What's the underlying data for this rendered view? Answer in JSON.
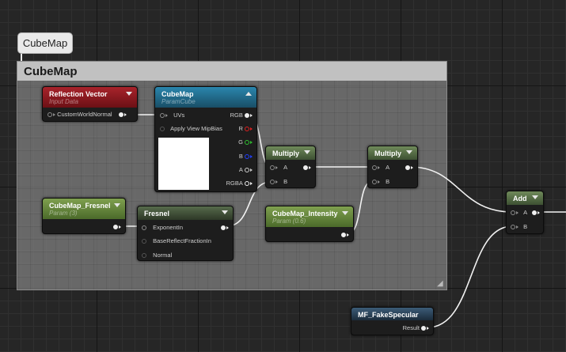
{
  "comment_tag": "CubeMap",
  "comment_title": "CubeMap",
  "nodes": {
    "reflection_vector": {
      "title": "Reflection Vector",
      "subtitle": "Input Data",
      "outputs": [
        "CustomWorldNormal"
      ]
    },
    "cubemap": {
      "title": "CubeMap",
      "subtitle": "ParamCube",
      "inputs": [
        "UVs",
        "Apply View MipBias"
      ],
      "outputs": [
        "RGB",
        "R",
        "G",
        "B",
        "A",
        "RGBA"
      ]
    },
    "cubemap_fresnel": {
      "title": "CubeMap_Fresnel",
      "subtitle": "Param (3)"
    },
    "fresnel": {
      "title": "Fresnel",
      "inputs": [
        "ExponentIn",
        "BaseReflectFractionIn",
        "Normal"
      ]
    },
    "multiply_1": {
      "title": "Multiply",
      "inputs": [
        "A",
        "B"
      ]
    },
    "cubemap_intensity": {
      "title": "CubeMap_Intensity",
      "subtitle": "Param (0.6)"
    },
    "multiply_2": {
      "title": "Multiply",
      "inputs": [
        "A",
        "B"
      ]
    },
    "add": {
      "title": "Add",
      "inputs": [
        "A",
        "B"
      ]
    },
    "mf_fakespecular": {
      "title": "MF_FakeSpecular",
      "outputs": [
        "Result"
      ]
    }
  },
  "colors": {
    "channel_r": "#e02020",
    "channel_g": "#30c030",
    "channel_b": "#2040ff"
  }
}
